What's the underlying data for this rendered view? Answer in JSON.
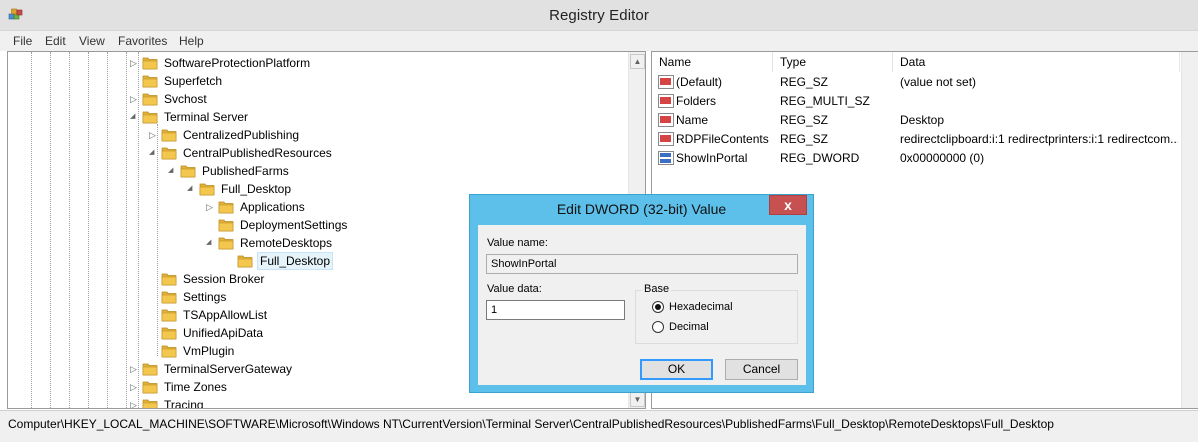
{
  "window": {
    "title": "Registry Editor",
    "icon": "regedit-icon"
  },
  "menu": [
    "File",
    "Edit",
    "View",
    "Favorites",
    "Help"
  ],
  "tree": [
    {
      "label": "SoftwareProtectionPlatform",
      "level": 0,
      "expander": "collapsed"
    },
    {
      "label": "Superfetch",
      "level": 0,
      "expander": "none"
    },
    {
      "label": "Svchost",
      "level": 0,
      "expander": "collapsed"
    },
    {
      "label": "Terminal Server",
      "level": 0,
      "expander": "expanded"
    },
    {
      "label": "CentralizedPublishing",
      "level": 1,
      "expander": "collapsed"
    },
    {
      "label": "CentralPublishedResources",
      "level": 1,
      "expander": "expanded"
    },
    {
      "label": "PublishedFarms",
      "level": 2,
      "expander": "expanded"
    },
    {
      "label": "Full_Desktop",
      "level": 3,
      "expander": "expanded"
    },
    {
      "label": "Applications",
      "level": 4,
      "expander": "collapsed"
    },
    {
      "label": "DeploymentSettings",
      "level": 4,
      "expander": "none"
    },
    {
      "label": "RemoteDesktops",
      "level": 4,
      "expander": "expanded"
    },
    {
      "label": "Full_Desktop",
      "level": 5,
      "expander": "none",
      "selected": true
    },
    {
      "label": "Session Broker",
      "level": 1,
      "expander": "none"
    },
    {
      "label": "Settings",
      "level": 1,
      "expander": "none"
    },
    {
      "label": "TSAppAllowList",
      "level": 1,
      "expander": "none"
    },
    {
      "label": "UnifiedApiData",
      "level": 1,
      "expander": "none"
    },
    {
      "label": "VmPlugin",
      "level": 1,
      "expander": "none"
    },
    {
      "label": "TerminalServerGateway",
      "level": 0,
      "expander": "collapsed"
    },
    {
      "label": "Time Zones",
      "level": 0,
      "expander": "collapsed"
    },
    {
      "label": "Tracing",
      "level": 0,
      "expander": "collapsed"
    }
  ],
  "list": {
    "columns": [
      "Name",
      "Type",
      "Data"
    ],
    "rows": [
      {
        "name": "(Default)",
        "type": "REG_SZ",
        "data": "(value not set)",
        "icon": "string-value-icon"
      },
      {
        "name": "Folders",
        "type": "REG_MULTI_SZ",
        "data": "",
        "icon": "string-value-icon"
      },
      {
        "name": "Name",
        "type": "REG_SZ",
        "data": "Desktop",
        "icon": "string-value-icon"
      },
      {
        "name": "RDPFileContents",
        "type": "REG_SZ",
        "data": "redirectclipboard:i:1 redirectprinters:i:1 redirectcom...",
        "icon": "string-value-icon"
      },
      {
        "name": "ShowInPortal",
        "type": "REG_DWORD",
        "data": "0x00000000 (0)",
        "icon": "binary-value-icon"
      }
    ]
  },
  "status": {
    "path": "Computer\\HKEY_LOCAL_MACHINE\\SOFTWARE\\Microsoft\\Windows NT\\CurrentVersion\\Terminal Server\\CentralPublishedResources\\PublishedFarms\\Full_Desktop\\RemoteDesktops\\Full_Desktop"
  },
  "dialog": {
    "title": "Edit DWORD (32-bit) Value",
    "close_glyph": "x",
    "value_name_label": "Value name:",
    "value_name": "ShowInPortal",
    "value_data_label": "Value data:",
    "value_data": "1",
    "base_label": "Base",
    "hex_label": "Hexadecimal",
    "dec_label": "Decimal",
    "selected_base": "Hexadecimal",
    "ok_label": "OK",
    "cancel_label": "Cancel"
  },
  "colors": {
    "dialog_frame": "#5cc0ea",
    "close_button": "#c75050",
    "selection": "#e5f3fb",
    "folder": "#f3c64d"
  }
}
